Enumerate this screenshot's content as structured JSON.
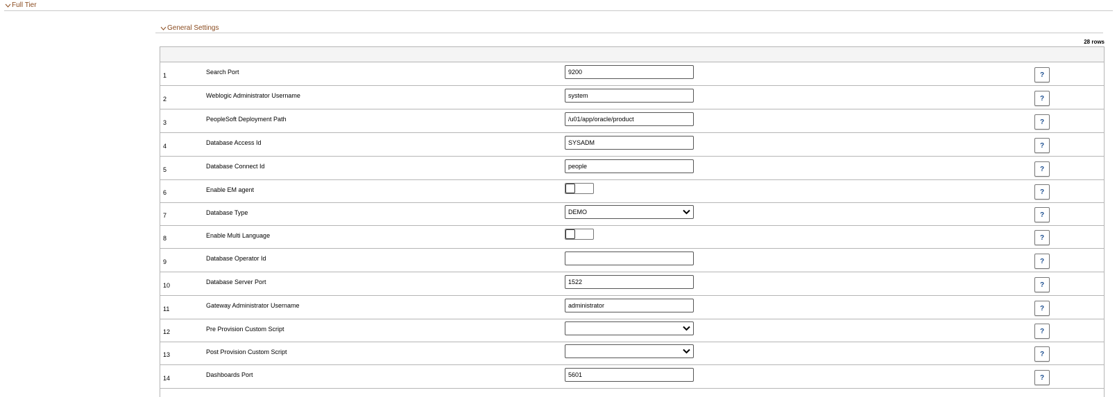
{
  "sections": {
    "full_tier": "Full Tier",
    "general_settings": "General Settings"
  },
  "grid": {
    "rows_count": "28 rows",
    "help_label": "?",
    "rows": [
      {
        "num": "1",
        "label": "Search Port",
        "type": "text",
        "value": "9200"
      },
      {
        "num": "2",
        "label": "Weblogic Administrator Username",
        "type": "text",
        "value": "system"
      },
      {
        "num": "3",
        "label": "PeopleSoft Deployment Path",
        "type": "text",
        "value": "/u01/app/oracle/product"
      },
      {
        "num": "4",
        "label": "Database Access Id",
        "type": "text",
        "value": "SYSADM"
      },
      {
        "num": "5",
        "label": "Database Connect Id",
        "type": "text",
        "value": "people"
      },
      {
        "num": "6",
        "label": "Enable EM agent",
        "type": "checkbox",
        "value": ""
      },
      {
        "num": "7",
        "label": "Database Type",
        "type": "select",
        "value": "DEMO"
      },
      {
        "num": "8",
        "label": "Enable Multi Language",
        "type": "checkbox",
        "value": ""
      },
      {
        "num": "9",
        "label": "Database Operator Id",
        "type": "text",
        "value": ""
      },
      {
        "num": "10",
        "label": "Database Server Port",
        "type": "text",
        "value": "1522"
      },
      {
        "num": "11",
        "label": "Gateway Administrator Username",
        "type": "text",
        "value": "administrator"
      },
      {
        "num": "12",
        "label": "Pre Provision Custom Script",
        "type": "select",
        "value": ""
      },
      {
        "num": "13",
        "label": "Post Provision Custom Script",
        "type": "select",
        "value": ""
      },
      {
        "num": "14",
        "label": "Dashboards Port",
        "type": "text",
        "value": "5601"
      }
    ]
  }
}
